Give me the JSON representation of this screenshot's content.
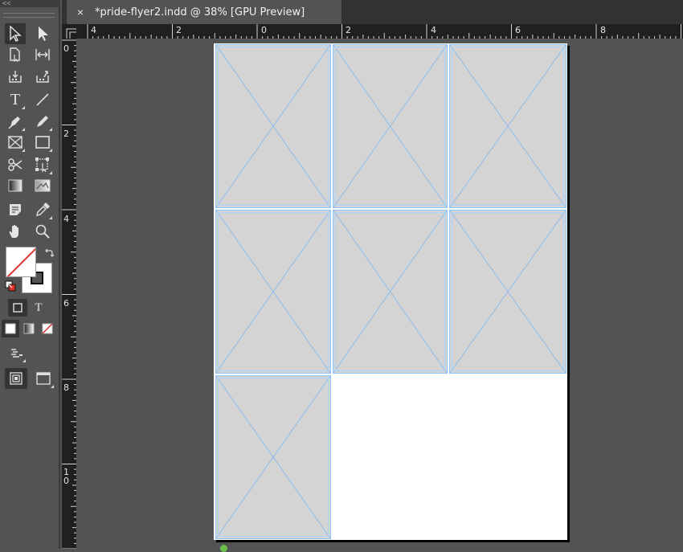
{
  "tools_panel": {
    "collapse_label": "<<",
    "tools": [
      {
        "name": "selection-tool-icon"
      },
      {
        "name": "direct-selection-tool-icon"
      },
      {
        "name": "page-tool-icon"
      },
      {
        "name": "gap-tool-icon"
      },
      {
        "name": "content-collector-icon"
      },
      {
        "name": "content-placer-icon"
      },
      {
        "name": "type-tool-icon",
        "glyph": "T"
      },
      {
        "name": "line-tool-icon"
      },
      {
        "name": "pen-tool-icon"
      },
      {
        "name": "pencil-tool-icon"
      },
      {
        "name": "rectangle-frame-tool-icon"
      },
      {
        "name": "rectangle-tool-icon"
      },
      {
        "name": "scissors-tool-icon"
      },
      {
        "name": "free-transform-tool-icon"
      },
      {
        "name": "gradient-swatch-tool-icon"
      },
      {
        "name": "gradient-feather-tool-icon"
      },
      {
        "name": "note-tool-icon"
      },
      {
        "name": "eyedropper-tool-icon"
      },
      {
        "name": "hand-tool-icon"
      },
      {
        "name": "zoom-tool-icon"
      }
    ],
    "swap_icon": "swap-fill-stroke-icon",
    "default_icon": "default-fill-stroke-icon",
    "formatting_container": "container-formatting-icon",
    "formatting_text": "T",
    "apply_color": "apply-color-icon",
    "apply_gradient": "apply-gradient-icon",
    "apply_none": "apply-none-icon",
    "preview_mode": "preview-mode-icon",
    "view_mode": "normal-view-icon",
    "screen_mode": "screen-mode-icon",
    "colors": {
      "fill": "#ffffff",
      "none_slash": "#e0322c",
      "stroke_inner": "#535353"
    }
  },
  "document_tab": {
    "close_label": "×",
    "title": "*pride-flyer2.indd @ 38% [GPU Preview]"
  },
  "ruler_h": {
    "labels": [
      "4",
      "2",
      "0",
      "2",
      "4",
      "6",
      "8"
    ]
  },
  "ruler_v": {
    "labels": [
      "0",
      "2",
      "4",
      "6",
      "8",
      "1\n0"
    ]
  },
  "canvas": {
    "frames_count": 7,
    "colors": {
      "frame_fill": "#d4d4d4",
      "frame_guide": "#7fb8f0",
      "page": "#ffffff"
    }
  }
}
